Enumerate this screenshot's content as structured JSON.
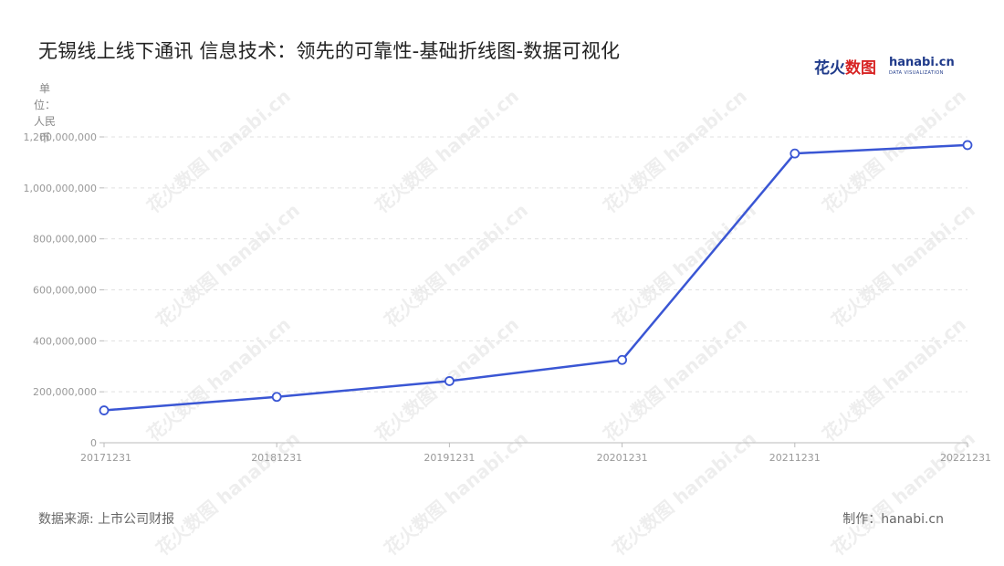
{
  "title": "无锡线上线下通讯 信息技术：领先的可靠性-基础折线图-数据可视化",
  "logo": {
    "cn_main": "花火",
    "cn_accent": "数图",
    "en": "hanabi.cn",
    "sub": "DATA VISUALIZATION"
  },
  "y_unit": "单位：人民币",
  "source": "数据来源: 上市公司财报",
  "maker": "制作：hanabi.cn",
  "watermark": "花火数图 hanabi.cn",
  "colors": {
    "line": "#3a56d4",
    "point_fill": "#ffffff",
    "grid": "#e0e0e0",
    "axis": "#bbbbbb",
    "tick_text": "#999999"
  },
  "chart_data": {
    "type": "line",
    "x": [
      "20171231",
      "20181231",
      "20191231",
      "20201231",
      "20211231",
      "20221231"
    ],
    "values": [
      127000000,
      180000000,
      242000000,
      325000000,
      1135000000,
      1168000000
    ],
    "ylim": [
      0,
      1200000000
    ],
    "yticks": [
      0,
      200000000,
      400000000,
      600000000,
      800000000,
      1000000000,
      1200000000
    ],
    "ytick_labels": [
      "0",
      "200,000,000",
      "400,000,000",
      "600,000,000",
      "800,000,000",
      "1,000,000,000",
      "1,200,000,000"
    ],
    "grid": true,
    "legend": "none"
  }
}
